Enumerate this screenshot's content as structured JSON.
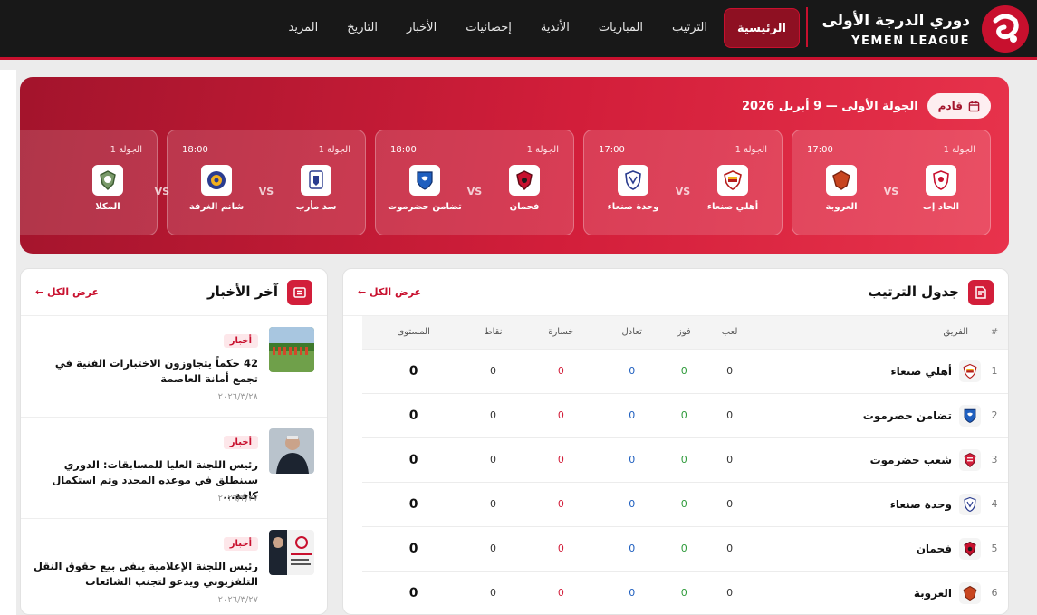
{
  "brand": {
    "name_ar": "دوري الدرجة الأولى",
    "name_en": "YEMEN LEAGUE"
  },
  "nav": [
    {
      "label": "الرئيسية",
      "active": true
    },
    {
      "label": "الترتيب"
    },
    {
      "label": "المباريات"
    },
    {
      "label": "الأندية"
    },
    {
      "label": "إحصائيات"
    },
    {
      "label": "الأخبار"
    },
    {
      "label": "التاريخ"
    },
    {
      "label": "المزيد"
    }
  ],
  "hero": {
    "badge": "قادم",
    "title": "الجولة الأولى — 9 أبريل 2026",
    "vs": "VS",
    "matches": [
      {
        "round": "الجولة 1",
        "time": "17:00",
        "home": "الحاد إب",
        "away": "العروبة"
      },
      {
        "round": "الجولة 1",
        "time": "17:00",
        "home": "أهلي صنعاء",
        "away": "وحدة صنعاء"
      },
      {
        "round": "الجولة 1",
        "time": "18:00",
        "home": "فحمان",
        "away": "تضامن حضرموت"
      },
      {
        "round": "الجولة 1",
        "time": "18:00",
        "home": "سد مأرب",
        "away": "شانم الغرفة"
      },
      {
        "round": "الجولة 1",
        "time": "",
        "home": "",
        "away": "المكلا"
      }
    ]
  },
  "standings": {
    "title": "جدول الترتيب",
    "view_all": "عرض الكل ←",
    "columns": [
      "#",
      "الفريق",
      "لعب",
      "فوز",
      "تعادل",
      "خسارة",
      "نقاط",
      "المستوى"
    ],
    "rows": [
      {
        "rank": "1",
        "team": "أهلي صنعاء",
        "played": "0",
        "won": "0",
        "drawn": "0",
        "lost": "0",
        "points": "0",
        "level": "0"
      },
      {
        "rank": "2",
        "team": "تضامن حضرموت",
        "played": "0",
        "won": "0",
        "drawn": "0",
        "lost": "0",
        "points": "0",
        "level": "0"
      },
      {
        "rank": "3",
        "team": "شعب حضرموت",
        "played": "0",
        "won": "0",
        "drawn": "0",
        "lost": "0",
        "points": "0",
        "level": "0"
      },
      {
        "rank": "4",
        "team": "وحدة صنعاء",
        "played": "0",
        "won": "0",
        "drawn": "0",
        "lost": "0",
        "points": "0",
        "level": "0"
      },
      {
        "rank": "5",
        "team": "فحمان",
        "played": "0",
        "won": "0",
        "drawn": "0",
        "lost": "0",
        "points": "0",
        "level": "0"
      },
      {
        "rank": "6",
        "team": "العروبة",
        "played": "0",
        "won": "0",
        "drawn": "0",
        "lost": "0",
        "points": "0",
        "level": "0"
      }
    ]
  },
  "news": {
    "title": "آخر الأخبار",
    "view_all": "عرض الكل ←",
    "items": [
      {
        "tag": "أخبار",
        "title": "42 حكماً يتجاوزون الاختبارات الفنية في تجمع أمانة العاصمة",
        "date": "٢٠٢٦/٣/٢٨"
      },
      {
        "tag": "أخبار",
        "title": "رئيس اللجنة العليا للمسابقات: الدوري سينطلق في موعده المحدد وتم استكمال كافة...",
        "date": "٢٠٢٦/٣/٢٧"
      },
      {
        "tag": "أخبار",
        "title": "رئيس اللجنة الإعلامية ينفي بيع حقوق النقل التلفزيوني ويدعو لتجنب الشائعات",
        "date": "٢٠٢٦/٣/٢٧"
      }
    ]
  },
  "colors": {
    "accent": "#c8102e",
    "header_bg": "#181818",
    "hero_gradient_start": "#a3142c",
    "hero_gradient_end": "#e8334c"
  }
}
